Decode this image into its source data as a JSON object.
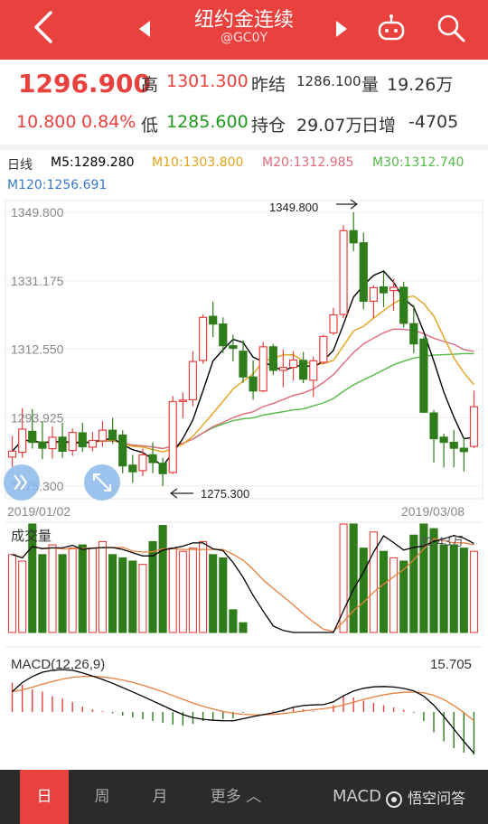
{
  "header": {
    "title": "纽约金连续",
    "code": "@GC0Y"
  },
  "quote": {
    "price": "1296.900",
    "change": "10.800",
    "change_pct": "0.84%",
    "high_label": "高",
    "high": "1301.300",
    "low_label": "低",
    "low": "1285.600",
    "prev_label": "昨结",
    "prev": "1286.100",
    "vol_label": "量",
    "vol": "19.26万",
    "oi_label": "持仓",
    "oi": "29.07万",
    "oi_change_label": "日增",
    "oi_change": "-4705"
  },
  "ma_legend": {
    "period": "日线",
    "m5": "M5:1289.280",
    "m10": "M10:1303.800",
    "m20": "M20:1312.985",
    "m30": "M30:1312.740",
    "m120": "M120:1256.691"
  },
  "colors": {
    "up": "#e8413e",
    "down": "#2e7d1a",
    "m5": "#000000",
    "m10": "#e3a21a",
    "m20": "#e06a7a",
    "m30": "#55b848",
    "macd": "#000000",
    "signal": "#e8803c"
  },
  "chart_data": [
    {
      "type": "candlestick",
      "title": "",
      "y_ticks": [
        "1349.800",
        "1331.175",
        "1312.550",
        "1293.925",
        "1275.300"
      ],
      "ylim": [
        1275.3,
        1349.8
      ],
      "x_start_label": "2019/01/02",
      "x_end_label": "2019/03/08",
      "max_annotation": "1349.800",
      "min_annotation": "1275.300",
      "candles": [
        {
          "o": 1283.2,
          "h": 1289.0,
          "l": 1280.5,
          "c": 1284.8
        },
        {
          "o": 1284.5,
          "h": 1296.5,
          "l": 1283.0,
          "c": 1290.8
        },
        {
          "o": 1290.2,
          "h": 1296.2,
          "l": 1285.5,
          "c": 1287.2
        },
        {
          "o": 1287.3,
          "h": 1293.0,
          "l": 1282.6,
          "c": 1285.6
        },
        {
          "o": 1285.5,
          "h": 1291.5,
          "l": 1282.8,
          "c": 1288.6
        },
        {
          "o": 1288.6,
          "h": 1292.5,
          "l": 1283.0,
          "c": 1284.8
        },
        {
          "o": 1285.0,
          "h": 1291.0,
          "l": 1283.5,
          "c": 1289.9
        },
        {
          "o": 1289.8,
          "h": 1292.5,
          "l": 1284.6,
          "c": 1286.0
        },
        {
          "o": 1285.9,
          "h": 1290.0,
          "l": 1284.8,
          "c": 1287.7
        },
        {
          "o": 1287.6,
          "h": 1293.0,
          "l": 1286.0,
          "c": 1290.5
        },
        {
          "o": 1290.5,
          "h": 1293.8,
          "l": 1286.8,
          "c": 1287.9
        },
        {
          "o": 1289.2,
          "h": 1290.5,
          "l": 1278.8,
          "c": 1280.8
        },
        {
          "o": 1281.0,
          "h": 1283.8,
          "l": 1276.2,
          "c": 1279.2
        },
        {
          "o": 1279.5,
          "h": 1285.5,
          "l": 1278.0,
          "c": 1283.8
        },
        {
          "o": 1283.8,
          "h": 1287.2,
          "l": 1278.8,
          "c": 1281.7
        },
        {
          "o": 1281.5,
          "h": 1283.0,
          "l": 1275.3,
          "c": 1278.7
        },
        {
          "o": 1279.0,
          "h": 1299.8,
          "l": 1278.6,
          "c": 1298.3
        },
        {
          "o": 1298.3,
          "h": 1300.8,
          "l": 1293.8,
          "c": 1298.7
        },
        {
          "o": 1298.8,
          "h": 1312.0,
          "l": 1297.0,
          "c": 1309.2
        },
        {
          "o": 1309.5,
          "h": 1322.0,
          "l": 1308.6,
          "c": 1321.2
        },
        {
          "o": 1321.5,
          "h": 1325.5,
          "l": 1315.8,
          "c": 1319.4
        },
        {
          "o": 1319.4,
          "h": 1321.2,
          "l": 1311.5,
          "c": 1313.5
        },
        {
          "o": 1313.5,
          "h": 1316.5,
          "l": 1309.2,
          "c": 1312.8
        },
        {
          "o": 1312.0,
          "h": 1315.0,
          "l": 1303.4,
          "c": 1305.0
        },
        {
          "o": 1305.0,
          "h": 1309.5,
          "l": 1298.8,
          "c": 1301.2
        },
        {
          "o": 1301.2,
          "h": 1314.5,
          "l": 1300.8,
          "c": 1313.2
        },
        {
          "o": 1313.2,
          "h": 1314.0,
          "l": 1305.5,
          "c": 1306.8
        },
        {
          "o": 1306.8,
          "h": 1312.5,
          "l": 1302.2,
          "c": 1307.6
        },
        {
          "o": 1307.6,
          "h": 1312.0,
          "l": 1304.0,
          "c": 1309.6
        },
        {
          "o": 1309.5,
          "h": 1311.8,
          "l": 1303.3,
          "c": 1304.4
        },
        {
          "o": 1304.1,
          "h": 1310.5,
          "l": 1299.6,
          "c": 1309.4
        },
        {
          "o": 1309.0,
          "h": 1316.5,
          "l": 1308.5,
          "c": 1316.0
        },
        {
          "o": 1317.0,
          "h": 1323.8,
          "l": 1316.4,
          "c": 1321.9
        },
        {
          "o": 1322.0,
          "h": 1346.3,
          "l": 1321.0,
          "c": 1344.8
        },
        {
          "o": 1344.8,
          "h": 1349.8,
          "l": 1339.2,
          "c": 1341.5
        },
        {
          "o": 1341.5,
          "h": 1344.3,
          "l": 1323.4,
          "c": 1325.6
        },
        {
          "o": 1325.6,
          "h": 1330.0,
          "l": 1321.0,
          "c": 1329.3
        },
        {
          "o": 1329.5,
          "h": 1333.6,
          "l": 1324.0,
          "c": 1327.9
        },
        {
          "o": 1328.5,
          "h": 1331.7,
          "l": 1323.0,
          "c": 1329.4
        },
        {
          "o": 1329.4,
          "h": 1330.9,
          "l": 1318.5,
          "c": 1319.6
        },
        {
          "o": 1319.5,
          "h": 1324.6,
          "l": 1311.5,
          "c": 1314.0
        },
        {
          "o": 1315.3,
          "h": 1316.0,
          "l": 1295.2,
          "c": 1295.4
        },
        {
          "o": 1295.2,
          "h": 1296.0,
          "l": 1281.7,
          "c": 1288.2
        },
        {
          "o": 1288.6,
          "h": 1289.6,
          "l": 1280.4,
          "c": 1287.2
        },
        {
          "o": 1287.2,
          "h": 1290.6,
          "l": 1280.4,
          "c": 1285.6
        },
        {
          "o": 1285.6,
          "h": 1288.4,
          "l": 1279.3,
          "c": 1284.7
        },
        {
          "o": 1286.1,
          "h": 1301.3,
          "l": 1285.6,
          "c": 1296.9
        }
      ]
    },
    {
      "type": "bar",
      "title": "成交量",
      "max_label": "33.43万",
      "vol_max": 33.43,
      "values": [
        24,
        22,
        33.43,
        24,
        27,
        24,
        26,
        27,
        26,
        28,
        24,
        23,
        22,
        21,
        28,
        33,
        26,
        25,
        26,
        28,
        24,
        23,
        7,
        3,
        0,
        0,
        0,
        0,
        0,
        0,
        0,
        0,
        0,
        33.43,
        33.43,
        26,
        31,
        25,
        23,
        22,
        30,
        33.43,
        32,
        27,
        27,
        26,
        25
      ]
    },
    {
      "type": "histogram",
      "title": "MACD(12,26,9)",
      "value_label": "15.705",
      "values": [
        6.5,
        6.0,
        5.0,
        4.5,
        3.5,
        3.0,
        2.2,
        1.2,
        0.6,
        0.2,
        -0.3,
        -0.8,
        -1.2,
        -1.6,
        -2.0,
        -2.4,
        -2.8,
        -3.0,
        -2.6,
        -2.0,
        -1.8,
        -1.6,
        -1.4,
        -0.2,
        0.0,
        0.0,
        0.2,
        0.6,
        1.2,
        0.6,
        0.2,
        0.0,
        1.5,
        3.5,
        3.2,
        2.5,
        2.0,
        1.5,
        1.0,
        0.5,
        -0.2,
        -2.0,
        -4.5,
        -6.5,
        -8.0,
        -9.0,
        -9.5
      ]
    }
  ],
  "bottom_bar": {
    "tabs": [
      "日",
      "周",
      "月",
      "更多 ︿"
    ],
    "active_tab": "日",
    "macd_button": "MACD",
    "brand": "悟空问答"
  }
}
